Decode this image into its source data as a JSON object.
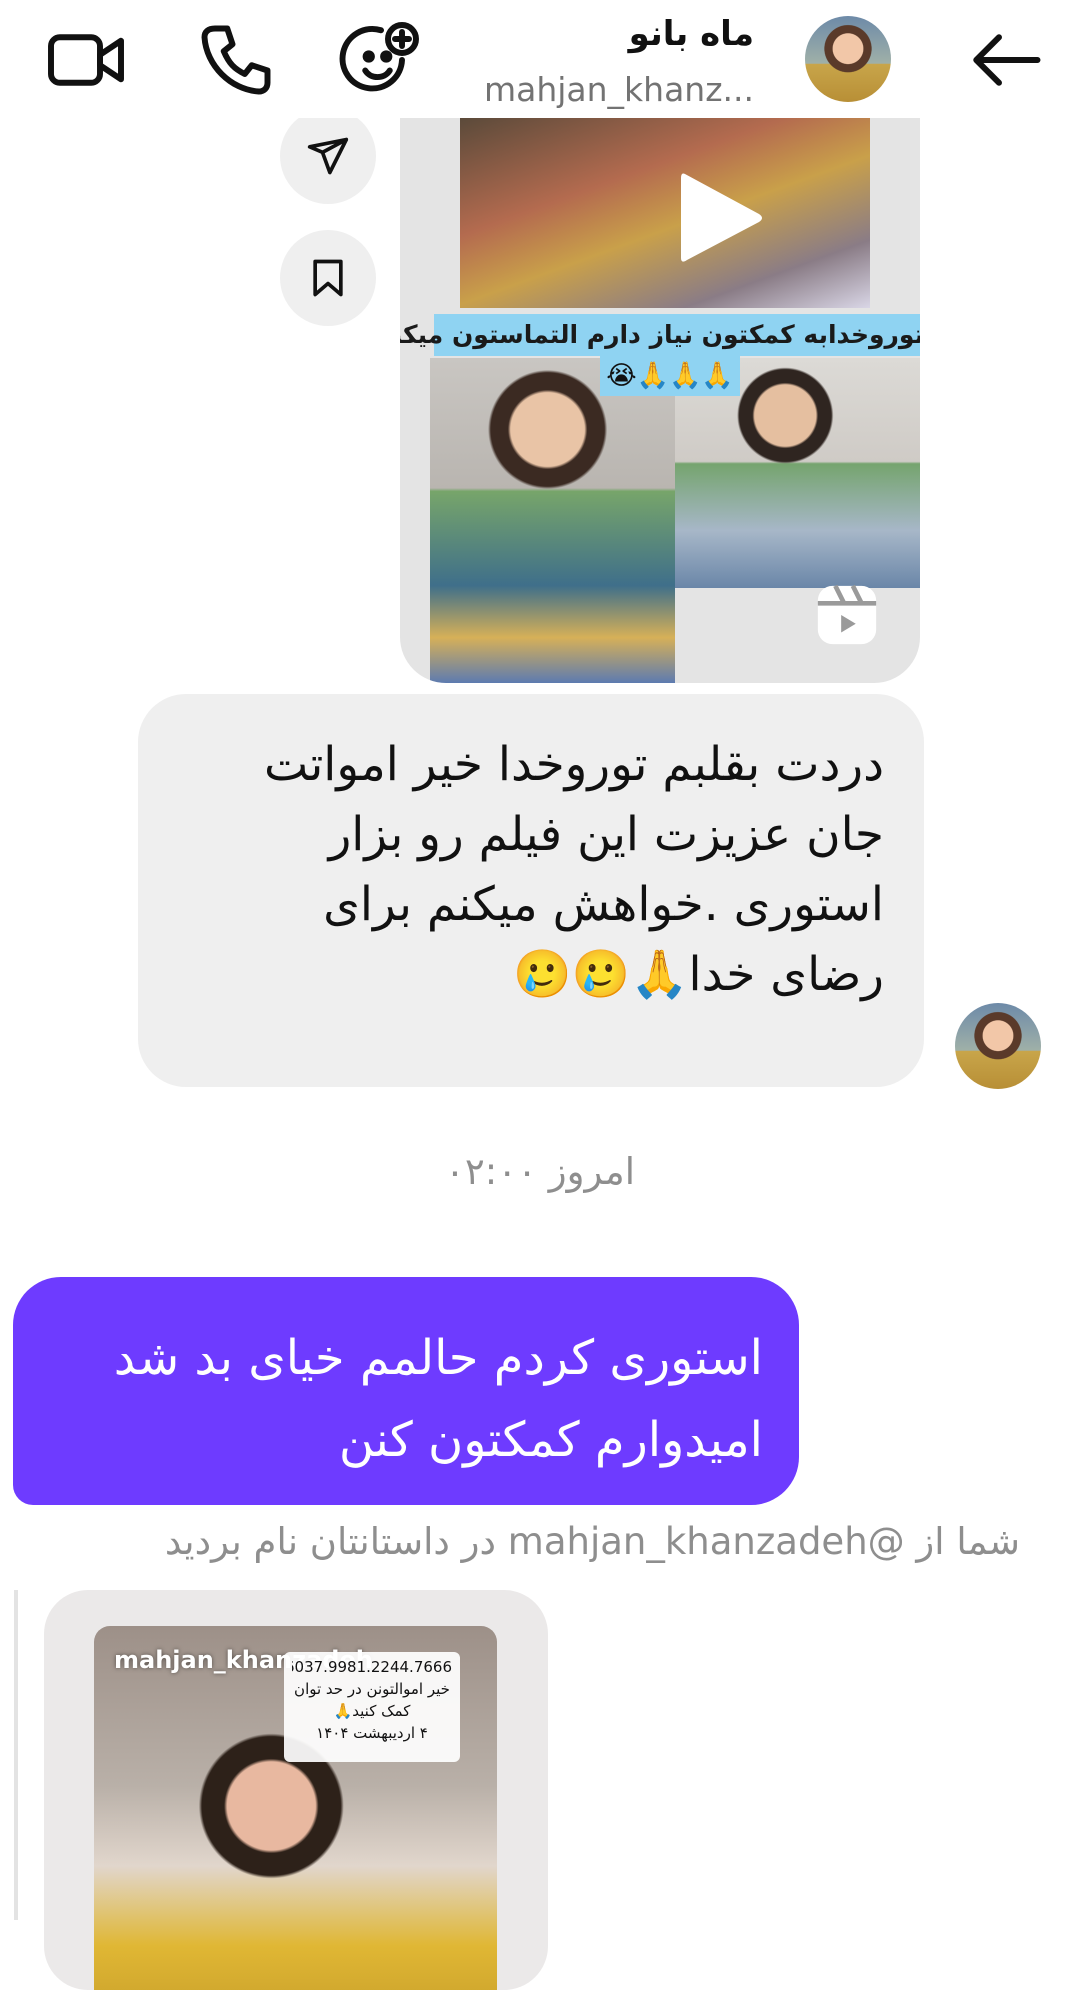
{
  "header": {
    "display_name": "ماه بانو",
    "username": "mahjan_khanz...",
    "icons": {
      "back": "arrow-left-icon",
      "video": "video-call-icon",
      "phone": "phone-call-icon",
      "effects": "face-plus-icon"
    }
  },
  "shared_reel": {
    "caption": "توروخدابه کمکتون نیاز دارم التماستون میکنم",
    "caption_emojis": "😭🙏🙏🙏",
    "icons": [
      "play-icon",
      "reels-icon",
      "share-icon",
      "bookmark-icon"
    ]
  },
  "incoming_message": {
    "lines": [
      "دردت بقلبم توروخدا خیر امواتت",
      "جان عزیزت این فیلم رو بزار",
      "استوری .خواهش میکنم برای",
      "رضای خدا🙏🥲🥲"
    ]
  },
  "timestamp": "امروز ۰۲:۰۰",
  "outgoing_message": {
    "lines": [
      "استوری کردم حالمم خیای بد شد",
      "امیدوارم کمکتون کنن"
    ]
  },
  "mention_note": "شما از @mahjan_khanzadeh در داستانتان نام بردید",
  "story_card": {
    "username": "mahjan_khanzadeh",
    "note_lines": [
      "6037.9981.2244.7666",
      "خیر اموالتونن در حد توان",
      "کمک کنید🙏",
      "۴ اردیبهشت ۱۴۰۴"
    ]
  },
  "colors": {
    "outgoing_bubble": "#6e3bff",
    "incoming_bubble": "#efefef",
    "secondary_text": "#8e8e8e"
  }
}
